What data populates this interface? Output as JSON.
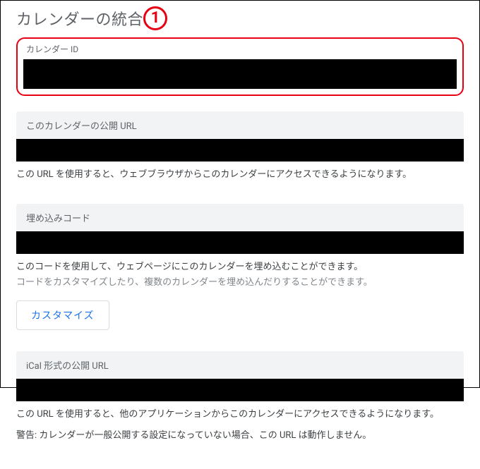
{
  "heading": "カレンダーの統合",
  "annotation_number": "1",
  "sections": {
    "calendar_id": {
      "label": "カレンダー ID"
    },
    "public_url": {
      "label": "このカレンダーの公開 URL",
      "desc": "この URL を使用すると、ウェブブラウザからこのカレンダーにアクセスできるようになります。"
    },
    "embed_code": {
      "label": "埋め込みコード",
      "desc1": "このコードを使用して、ウェブページにこのカレンダーを埋め込むことができます。",
      "desc2": "コードをカスタマイズしたり、複数のカレンダーを埋め込んだりすることができます。",
      "customize_btn": "カスタマイズ"
    },
    "ical_url": {
      "label": "iCal 形式の公開 URL",
      "desc": "この URL を使用すると、他のアプリケーションからこのカレンダーにアクセスできるようになります。",
      "warning": "警告: カレンダーが一般公開する設定になっていない場合、この URL は動作しません。"
    }
  }
}
